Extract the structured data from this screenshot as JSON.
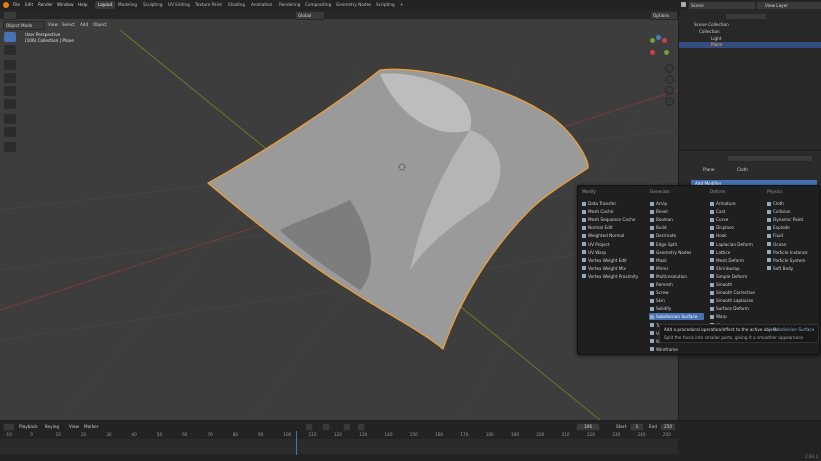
{
  "topbar": {
    "menus": [
      "File",
      "Edit",
      "Render",
      "Window",
      "Help"
    ],
    "workspaces": [
      "Layout",
      "Modeling",
      "Sculpting",
      "UV Editing",
      "Texture Paint",
      "Shading",
      "Animation",
      "Rendering",
      "Compositing",
      "Geometry Nodes",
      "Scripting"
    ],
    "active_workspace": "Layout",
    "scene": "Scene",
    "view_layer": "View Layer"
  },
  "viewport": {
    "mode": "Object Mode",
    "menus": [
      "View",
      "Select",
      "Add",
      "Object"
    ],
    "transform_orientation": "Global",
    "options_label": "Options",
    "perspective_label": "User Perspective",
    "collection_label": "(106) Collection | Plane"
  },
  "outliner": {
    "root": "Scene Collection",
    "collection": "Collection",
    "items": [
      "Light",
      "Plane"
    ]
  },
  "properties": {
    "object_name": "Plane",
    "modifier_name": "Cloth",
    "add_modifier_label": "Add Modifier"
  },
  "modifier_menu": {
    "columns": [
      {
        "title": "Modify",
        "items": [
          "Data Transfer",
          "Mesh Cache",
          "Mesh Sequence Cache",
          "Normal Edit",
          "Weighted Normal",
          "UV Project",
          "UV Warp",
          "Vertex Weight Edit",
          "Vertex Weight Mix",
          "Vertex Weight Proximity"
        ]
      },
      {
        "title": "Generate",
        "items": [
          "Array",
          "Bevel",
          "Boolean",
          "Build",
          "Decimate",
          "Edge Split",
          "Geometry Nodes",
          "Mask",
          "Mirror",
          "Multiresolution",
          "Remesh",
          "Screw",
          "Skin",
          "Solidify",
          "Subdivision Surface",
          "Triangulate",
          "Volume to Mesh",
          "Weld",
          "Wireframe"
        ]
      },
      {
        "title": "Deform",
        "items": [
          "Armature",
          "Cast",
          "Curve",
          "Displace",
          "Hook",
          "Laplacian Deform",
          "Lattice",
          "Mesh Deform",
          "Shrinkwrap",
          "Simple Deform",
          "Smooth",
          "Smooth Corrective",
          "Smooth Laplacian",
          "Surface Deform",
          "Warp",
          "Wave"
        ]
      },
      {
        "title": "Physics",
        "items": [
          "Cloth",
          "Collision",
          "Dynamic Paint",
          "Explode",
          "Fluid",
          "Ocean",
          "Particle Instance",
          "Particle System",
          "Soft Body"
        ]
      }
    ],
    "highlighted": "Subdivision Surface",
    "tooltip_line1": "Add a procedural operation/effect to the active object:",
    "tooltip_target": "Subdivision Surface",
    "tooltip_line2": "Split the faces into smaller parts, giving it a smoother appearance"
  },
  "timeline": {
    "menus": [
      "Playback",
      "Keying",
      "View",
      "Marker"
    ],
    "current_frame": "106",
    "start_label": "Start",
    "start": "1",
    "end_label": "End",
    "end": "250",
    "ticks": [
      "-10",
      "0",
      "10",
      "20",
      "30",
      "40",
      "50",
      "60",
      "70",
      "80",
      "90",
      "100",
      "110",
      "120",
      "130",
      "140",
      "150",
      "160",
      "170",
      "180",
      "190",
      "200",
      "210",
      "220",
      "230",
      "240",
      "250"
    ],
    "version": "2.93.1"
  }
}
